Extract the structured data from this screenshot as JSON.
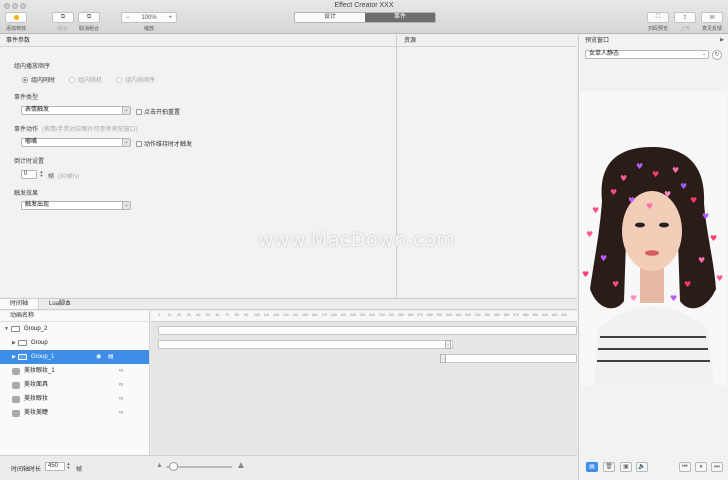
{
  "window": {
    "title": "Effect Creator XXX"
  },
  "toolbar": {
    "add_effect": "添加特效",
    "combine": "组合",
    "uncombine": "取消组合",
    "zoom_value": "100%",
    "zoom_minus": "−",
    "zoom_plus": "+",
    "zoom_label": "缩放",
    "scan_preview": "扫码预览",
    "upload": "上传",
    "feedback": "意见反馈"
  },
  "mode_tabs": [
    {
      "label": "设计",
      "active": false
    },
    {
      "label": "事件",
      "active": true
    }
  ],
  "event_params": {
    "header": "事件参数",
    "group_order_label": "组内播放顺序",
    "radio_options": [
      {
        "label": "组内同时",
        "checked": true,
        "enabled": true
      },
      {
        "label": "组内随机",
        "checked": false,
        "enabled": false
      },
      {
        "label": "组内按顺序",
        "checked": false,
        "enabled": false
      }
    ],
    "event_type_label": "事件类型",
    "event_type_value": "表情触发",
    "restart_on_click": "点击开拍重置",
    "event_action_label": "事件动作",
    "event_action_hint": "(表情/手势对应图片可参考预览窗口)",
    "event_action_value": "嘟嘴",
    "action_hold_trigger": "动作维持时才触发",
    "countdown_label": "倒计时设置",
    "countdown_value": "0",
    "countdown_unit": "帧",
    "countdown_hint": "(30帧/s)",
    "trigger_effect_label": "触发效果",
    "trigger_effect_value": "触发出现"
  },
  "resources": {
    "header": "资源"
  },
  "preview": {
    "header": "预览窗口",
    "dropdown_value": "女单人静态",
    "expand_arrow": "▶"
  },
  "timeline": {
    "tabs": [
      {
        "label": "时间轴",
        "active": true
      },
      {
        "label": "Lua脚本",
        "active": false
      }
    ],
    "tree_header": "动画名称",
    "ruler_ticks": [
      "0",
      "10",
      "20",
      "30",
      "40",
      "50",
      "60",
      "70",
      "80",
      "90",
      "100",
      "110",
      "120",
      "130",
      "140",
      "150",
      "160",
      "170",
      "180",
      "190",
      "200",
      "210",
      "220",
      "230",
      "240",
      "250",
      "260",
      "270",
      "280",
      "290",
      "300",
      "310",
      "320",
      "330",
      "340",
      "350",
      "360",
      "370",
      "380",
      "390",
      "400",
      "410",
      "420"
    ],
    "items": [
      {
        "label": "Group_2",
        "type": "group",
        "twisty": "▼",
        "indent": 0,
        "selected": false
      },
      {
        "label": "Group",
        "type": "group",
        "twisty": "▶",
        "indent": 1,
        "selected": false
      },
      {
        "label": "Group_1",
        "type": "group",
        "twisty": "▶",
        "indent": 1,
        "selected": true
      },
      {
        "label": "美妆眼妆_1",
        "type": "item",
        "twisty": "",
        "indent": 0,
        "selected": false
      },
      {
        "label": "美妆面具",
        "type": "item",
        "twisty": "",
        "indent": 0,
        "selected": false
      },
      {
        "label": "美妆眼妆",
        "type": "item",
        "twisty": "",
        "indent": 0,
        "selected": false
      },
      {
        "label": "美妆美睫",
        "type": "item",
        "twisty": "",
        "indent": 0,
        "selected": false
      }
    ],
    "duration_label": "时间轴时长",
    "duration_value": "450",
    "duration_unit": "帧"
  },
  "watermark": "www.MacDown.com"
}
